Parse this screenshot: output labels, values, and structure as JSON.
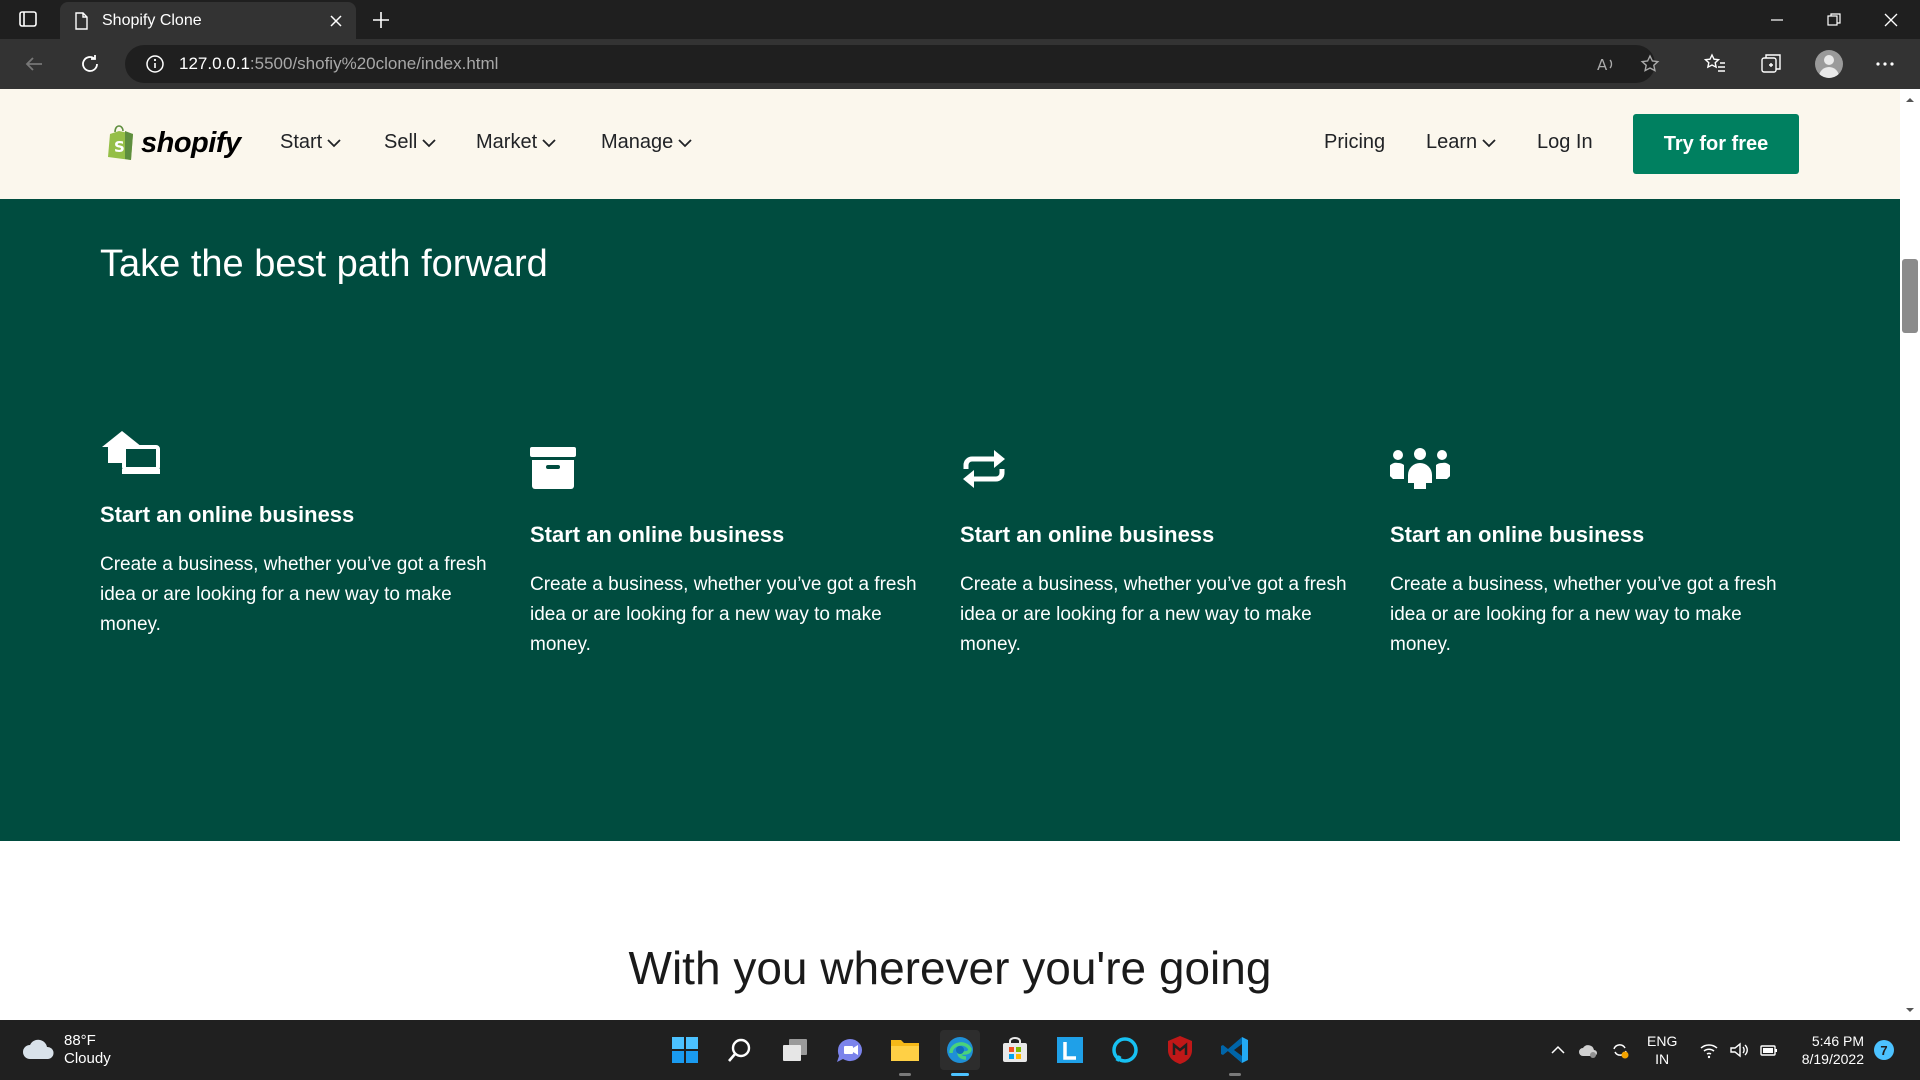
{
  "browser": {
    "tab_title": "Shopify Clone",
    "url_host": "127.0.0.1",
    "url_rest": ":5500/shofiy%20clone/index.html"
  },
  "header": {
    "logo_text": "shopify",
    "nav_left": [
      {
        "label": "Start"
      },
      {
        "label": "Sell"
      },
      {
        "label": "Market"
      },
      {
        "label": "Manage"
      }
    ],
    "nav_right": {
      "pricing": "Pricing",
      "learn": "Learn",
      "login": "Log In",
      "cta": "Try for free"
    }
  },
  "hero": {
    "title": "Take the best path forward",
    "features": [
      {
        "icon": "store-house-icon",
        "title": "Start an online business",
        "body": "Create a business, whether you’ve got a fresh idea or are looking for a new way to make money."
      },
      {
        "icon": "archive-box-icon",
        "title": "Start an online business",
        "body": "Create a business, whether you’ve got a fresh idea or are looking for a new way to make money."
      },
      {
        "icon": "repeat-arrows-icon",
        "title": "Start an online business",
        "body": "Create a business, whether you’ve got a fresh idea or are looking for a new way to make money."
      },
      {
        "icon": "people-group-icon",
        "title": "Start an online business",
        "body": "Create a business, whether you’ve got a fresh idea or are looking for a new way to make money."
      }
    ]
  },
  "section2": {
    "title": "With you wherever you're going"
  },
  "taskbar": {
    "weather_temp": "88°F",
    "weather_desc": "Cloudy",
    "lang_1": "ENG",
    "lang_2": "IN",
    "time": "5:46 PM",
    "date": "8/19/2022",
    "notifications": "7"
  },
  "colors": {
    "header_bg": "#fbf7ed",
    "hero_bg": "#004c3f",
    "cta_bg": "#008060"
  }
}
